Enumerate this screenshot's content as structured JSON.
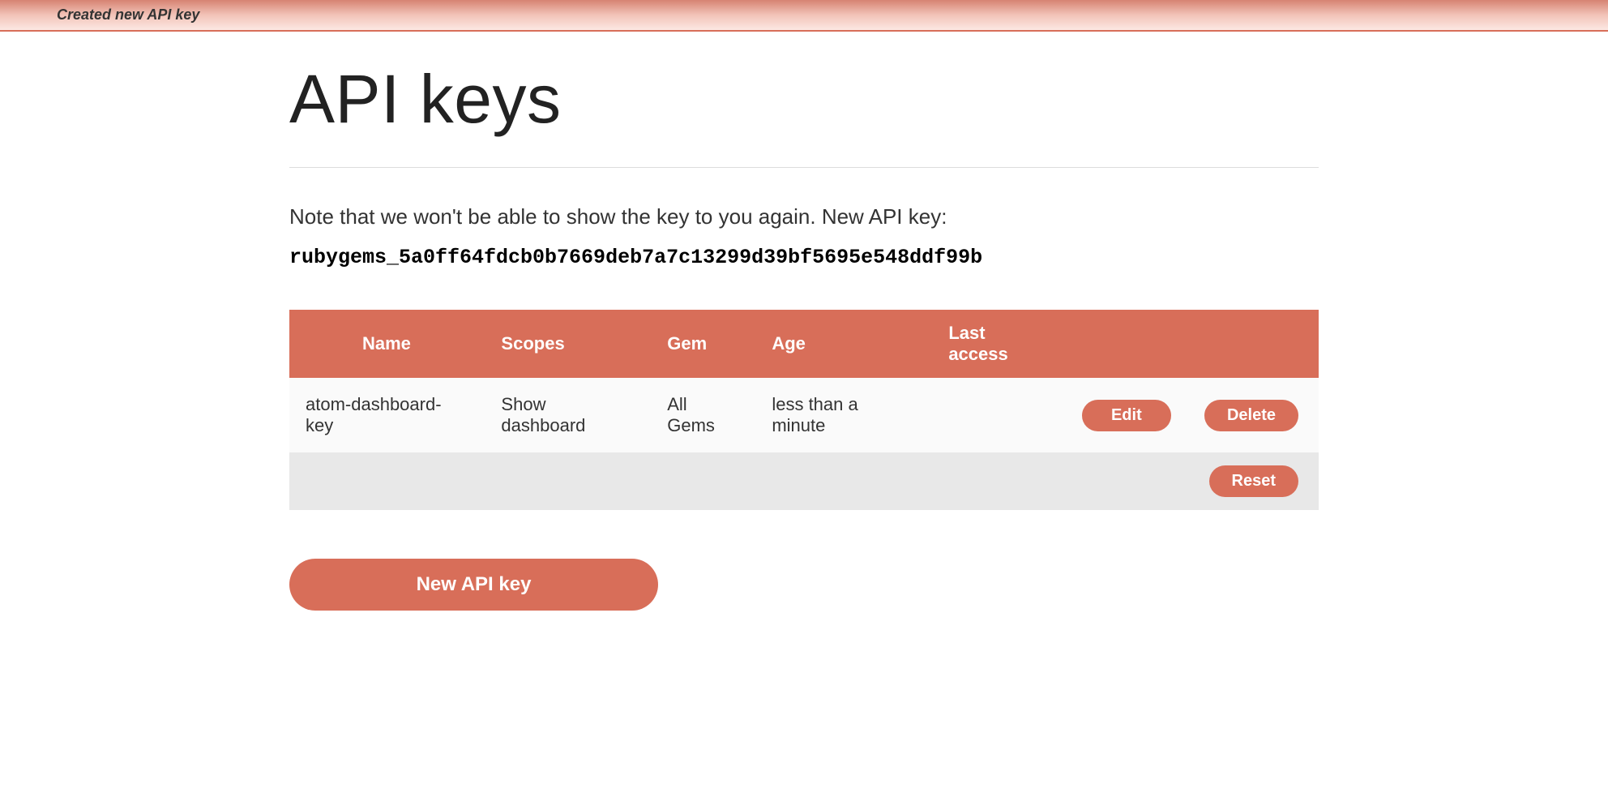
{
  "flash": {
    "message": "Created new API key"
  },
  "page": {
    "title": "API keys",
    "note": "Note that we won't be able to show the key to you again. New API key:",
    "api_key": "rubygems_5a0ff64fdcb0b7669deb7a7c13299d39bf5695e548ddf99b"
  },
  "table": {
    "headers": {
      "name": "Name",
      "scopes": "Scopes",
      "gem": "Gem",
      "age": "Age",
      "last_access": "Last access"
    },
    "rows": [
      {
        "name": "atom-dashboard-key",
        "scopes": "Show dashboard",
        "gem": "All Gems",
        "age": "less than a minute",
        "last_access": ""
      }
    ],
    "actions": {
      "edit": "Edit",
      "delete": "Delete",
      "reset": "Reset"
    }
  },
  "buttons": {
    "new_api_key": "New API key"
  }
}
